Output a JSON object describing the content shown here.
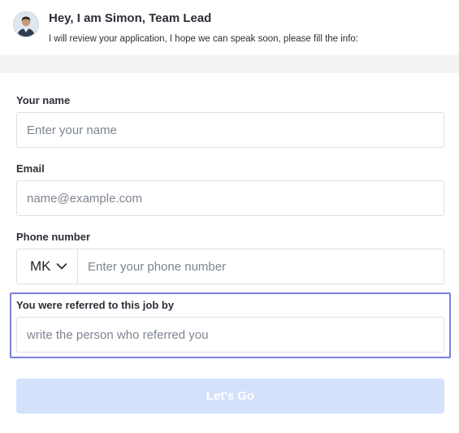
{
  "header": {
    "greeting": "Hey, I am Simon, Team Lead",
    "subtext": "I will review your application, I hope we can speak soon, please fill the info:"
  },
  "form": {
    "name_label": "Your name",
    "name_placeholder": "Enter your name",
    "email_label": "Email",
    "email_placeholder": "name@example.com",
    "phone_label": "Phone number",
    "phone_country_code": "MK",
    "phone_placeholder": "Enter your phone number",
    "referral_label": "You were referred to this job by",
    "referral_placeholder": "write the person who referred you",
    "submit_label": "Let's Go"
  },
  "colors": {
    "highlight_border": "#7b7fe0",
    "submit_bg_disabled": "#d3e1fb",
    "page_bg": "#f3f3f4"
  },
  "icons": {
    "avatar": "person-avatar",
    "country_dropdown": "chevron-down-icon"
  }
}
